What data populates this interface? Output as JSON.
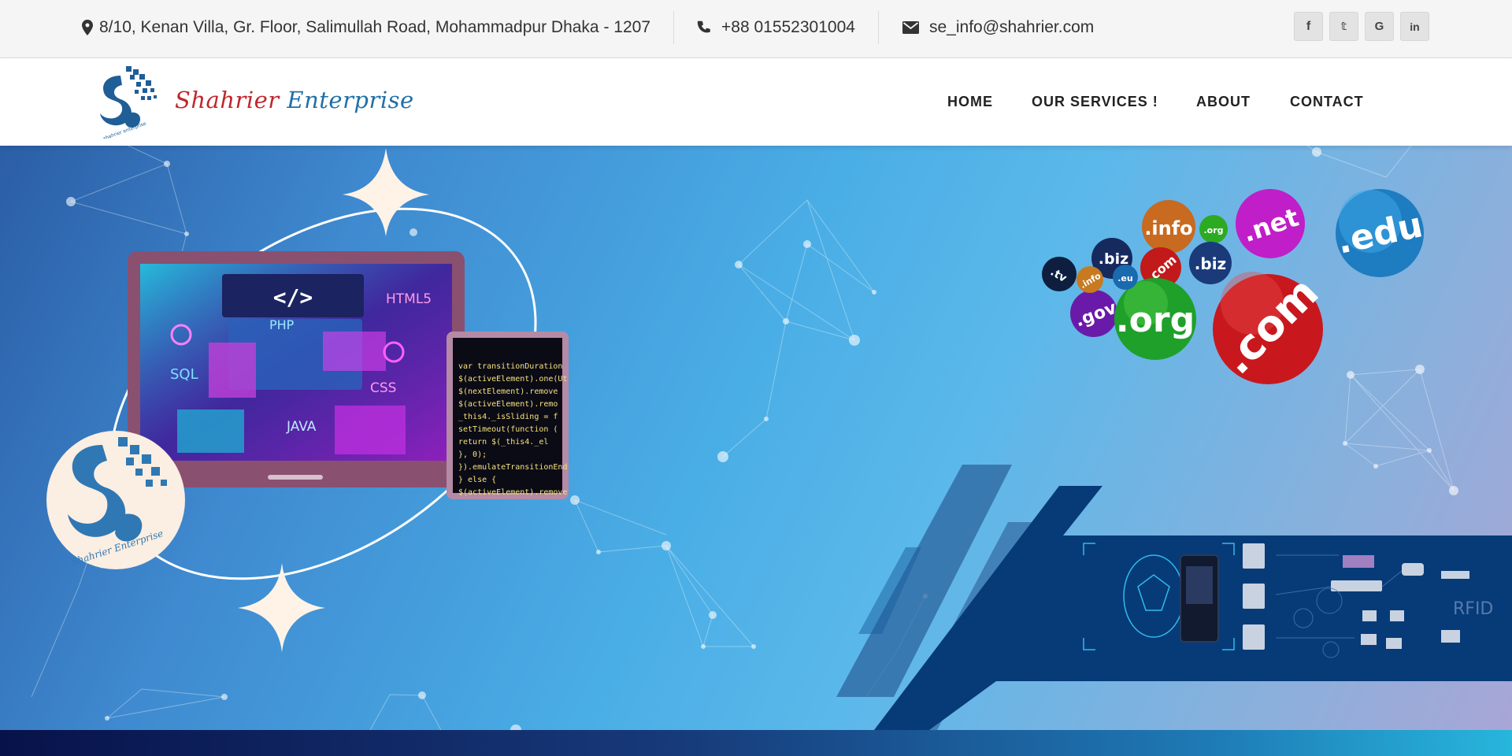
{
  "topbar": {
    "address": "8/10, Kenan Villa, Gr. Floor, Salimullah Road, Mohammadpur Dhaka - 1207",
    "phone": "+88 01552301004",
    "email": "se_info@shahrier.com",
    "address_icon": "map-marker-icon",
    "phone_icon": "phone-icon",
    "email_icon": "envelope-icon",
    "social": [
      {
        "label": "f",
        "icon": "facebook-icon"
      },
      {
        "label": "𝕥",
        "icon": "twitter-icon"
      },
      {
        "label": "G",
        "icon": "google-icon"
      },
      {
        "label": "in",
        "icon": "linkedin-icon"
      }
    ]
  },
  "brand": {
    "name_part1": "Shahrier",
    "name_part2": "Enterprise",
    "badge_text": "Shahrier Enterprise",
    "colors": {
      "red": "#c0262b",
      "blue": "#1f6fa8"
    }
  },
  "nav": {
    "items": [
      "HOME",
      "OUR SERVICES !",
      "ABOUT",
      "CONTACT"
    ]
  },
  "hero": {
    "laptop_labels": [
      "</>",
      "HTML5",
      "PHP",
      "SQL",
      "CSS",
      "JAVA"
    ],
    "code_lines": [
      "var transitionDuration",
      "$(activeElement).one(Ut",
      "  $(nextElement).remove",
      "  $(activeElement).remo",
      "  _this4._isSliding = f",
      "  setTimeout(function (",
      "    return $(_this4._el",
      "  }, 0);",
      "}).emulateTransitionEnd",
      "} else {",
      "  $(activeElement).remove"
    ],
    "domains": [
      ".edu",
      ".net",
      ".info",
      ".org",
      ".biz",
      ".com",
      ".com",
      ".biz",
      ".gov",
      ".org",
      ".tv",
      ".info",
      ".eu",
      ".org",
      ".com"
    ],
    "rfid_label": "RFID"
  }
}
